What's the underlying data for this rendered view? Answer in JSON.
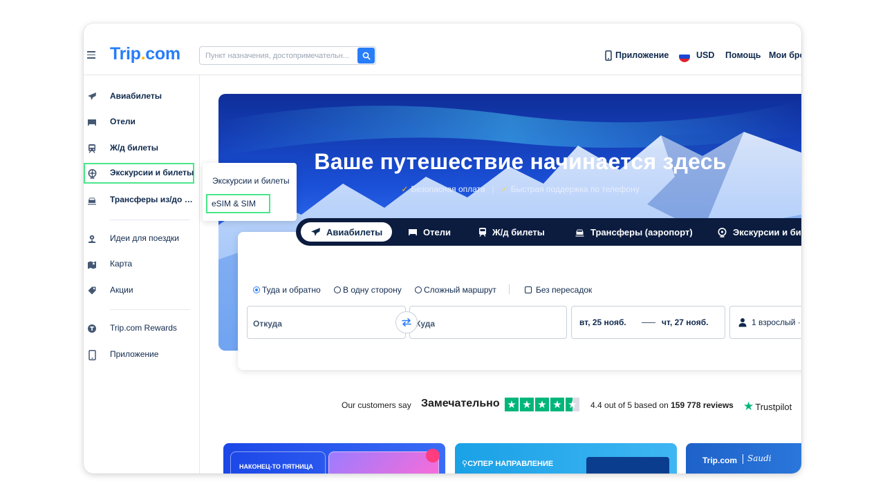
{
  "header": {
    "logo_main": "Trip",
    "logo_dot": ".",
    "logo_end": "com",
    "search_placeholder": "Пункт назначения, достопримечательн...",
    "app_label": "Приложение",
    "currency": "USD",
    "help": "Помощь",
    "bookings": "Мои бро"
  },
  "sidebar": {
    "items": [
      {
        "label": "Авиабилеты",
        "icon": "plane-icon"
      },
      {
        "label": "Отели",
        "icon": "bed-icon"
      },
      {
        "label": "Ж/д билеты",
        "icon": "train-icon"
      },
      {
        "label": "Экскурсии и билеты",
        "icon": "ferris-wheel-icon"
      },
      {
        "label": "Трансферы из/до аэ...",
        "icon": "car-icon"
      },
      {
        "label": "Идеи для поездки",
        "icon": "pin-person-icon"
      },
      {
        "label": "Карта",
        "icon": "map-icon"
      },
      {
        "label": "Акции",
        "icon": "tag-icon"
      },
      {
        "label": "Trip.com Rewards",
        "icon": "rewards-icon"
      },
      {
        "label": "Приложение",
        "icon": "phone-icon"
      }
    ]
  },
  "dropdown": {
    "items": [
      "Экскурсии и билеты",
      "eSIM & SIM"
    ]
  },
  "hero": {
    "title": "Ваше путешествие начинается здесь",
    "badge1": "Безопасная оплата",
    "badge2": "Быстрая поддержка по телефону",
    "badge_sep": "|"
  },
  "tabs": [
    "Авиабилеты",
    "Отели",
    "Ж/д билеты",
    "Трансферы (аэропорт)",
    "Экскурсии и би"
  ],
  "search_form": {
    "trip_types": [
      "Туда и обратно",
      "В одну сторону",
      "Сложный маршрут"
    ],
    "nonstop": "Без пересадок",
    "from_placeholder": "Откуда",
    "to_placeholder": "Куда",
    "date_from": "вт, 25 нояб.",
    "date_to": "чт, 27 нояб.",
    "passengers": "1 взрослый · :"
  },
  "trustpilot": {
    "say": "Our customers say",
    "rating_word": "Замечательно",
    "score_prefix": "4.4 out of 5 based on",
    "reviews": "159 778 reviews",
    "brand": "Trustpilot",
    "stars": 4.4
  },
  "promos": {
    "promo1": "НАКОНЕЦ-ТО ПЯТНИЦА",
    "promo2": "СУПЕР НАПРАВЛЕНИЕ",
    "promo3_brand": "Trip.com",
    "promo3_partner": "Saudi"
  },
  "colors": {
    "brand_blue": "#287dfa",
    "brand_yellow": "#ffb400",
    "highlight_green": "#49e68a",
    "trustpilot_green": "#00b67a",
    "tabs_bg": "#0b1c3f"
  }
}
